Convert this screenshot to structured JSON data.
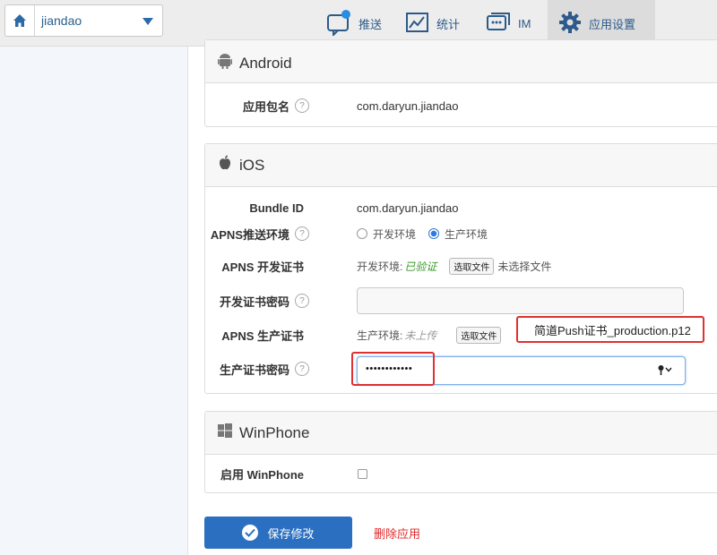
{
  "app_selector": {
    "name": "jiandao"
  },
  "nav": [
    {
      "label": "推送",
      "icon": "push-chat-icon"
    },
    {
      "label": "统计",
      "icon": "chart-icon"
    },
    {
      "label": "IM",
      "icon": "chat-icon"
    },
    {
      "label": "应用设置",
      "icon": "gear-icon"
    }
  ],
  "android": {
    "title": "Android",
    "package_label": "应用包名",
    "package_value": "com.daryun.jiandao"
  },
  "ios": {
    "title": "iOS",
    "bundle_label": "Bundle ID",
    "bundle_value": "com.daryun.jiandao",
    "apns_env_label": "APNS推送环境",
    "env_dev": "开发环境",
    "env_prod": "生产环境",
    "env_selected": "生产环境",
    "dev_cert_label": "APNS 开发证书",
    "dev_env_prefix": "开发环境:",
    "dev_status": "已验证",
    "choose_file": "选取文件",
    "dev_no_file": "未选择文件",
    "dev_pwd_label": "开发证书密码",
    "prod_cert_label": "APNS 生产证书",
    "prod_env_prefix": "生产环境:",
    "prod_status": "未上传",
    "prod_file": "简道Push证书_production.p12",
    "prod_pwd_label": "生产证书密码",
    "prod_pwd_value": "••••••••••••"
  },
  "winphone": {
    "title": "WinPhone",
    "enable_label": "启用 WinPhone"
  },
  "actions": {
    "save": "保存修改",
    "delete": "删除应用"
  },
  "colors": {
    "primary": "#2b6fc0",
    "danger": "#e02828",
    "verified": "#3a9a2a"
  }
}
